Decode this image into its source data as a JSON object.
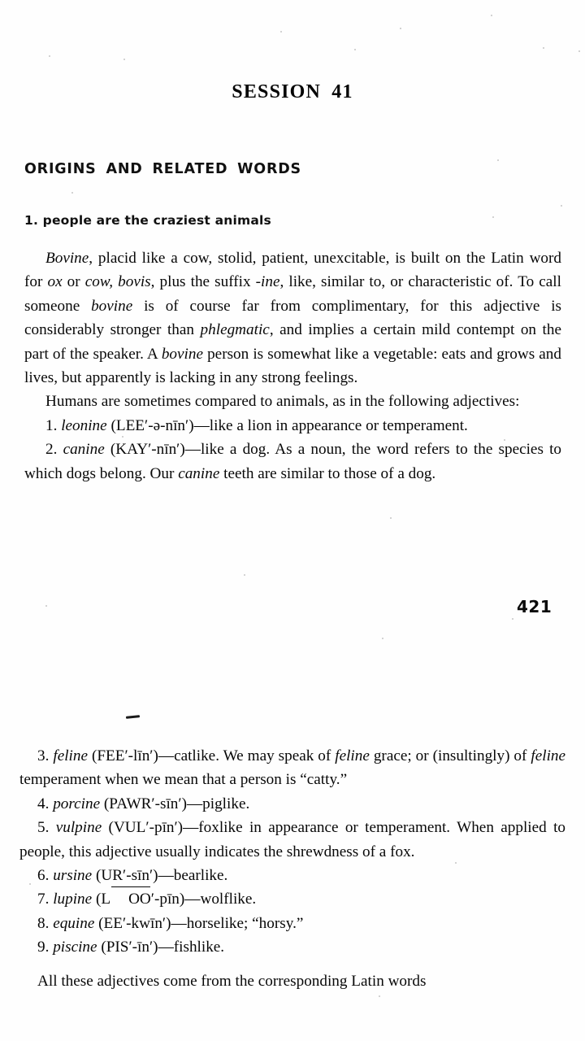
{
  "document": {
    "title": "SESSION 41",
    "page_number": "421",
    "section_heading": "ORIGINS AND RELATED WORDS",
    "subsection_heading": "1. people are the craziest animals"
  },
  "block_one": {
    "paragraph_bovine_lead": "Bovine",
    "paragraph_bovine": ", placid like a cow, stolid, patient, unexcitable, is built on the Latin word for ",
    "word_ox": "ox",
    "paragraph_bovine_2": " or ",
    "word_cow_bovis": "cow, bovis",
    "paragraph_bovine_3": ", plus the suffix ",
    "word_ine": "-ine",
    "paragraph_bovine_4": ", like, similar to, or characteristic of. To call someone ",
    "word_bovine_2": "bovine",
    "paragraph_bovine_5": " is of course far from complimentary, for this adjective is considerably stronger than ",
    "word_phlegmatic": "phlegmatic",
    "paragraph_bovine_6": ", and implies a certain mild contempt on the part of the speaker. A ",
    "word_bovine_3": "bovine",
    "paragraph_bovine_7": " person is somewhat like a vegetable: eats and grows and lives, but apparently is lacking in any strong feelings.",
    "paragraph_humans": "Humans are sometimes compared to animals, as in the following adjectives:",
    "item_1_number": "1. ",
    "item_1_word": "leonine",
    "item_1_rest": " (LEE′-ə-nīn′)—like a lion in appearance or temperament.",
    "item_2_number": "2. ",
    "item_2_word": "canine",
    "item_2_rest_a": " (KAY′-nīn′)—like a dog. As a noun, the word refers to the species to which dogs belong. Our ",
    "item_2_word_b": "canine",
    "item_2_rest_b": " teeth are similar to those of a dog."
  },
  "block_two": {
    "item_3_number": "3. ",
    "item_3_word": "feline",
    "item_3_rest_a": " (FEE′-līn′)—catlike. We may speak of ",
    "item_3_word_b": "feline",
    "item_3_rest_b": " grace; or (insultingly) of ",
    "item_3_word_c": "feline",
    "item_3_rest_c": " temperament when we mean that a person is “catty.”",
    "item_4_number": "4. ",
    "item_4_word": "porcine",
    "item_4_rest": " (PAWR′-sīn′)—piglike.",
    "item_5_number": "5. ",
    "item_5_word": "vulpine",
    "item_5_rest": " (VUL′-pīn′)—foxlike in appearance or temperament. When applied to people, this adjective usually indicates the shrewdness of a fox.",
    "item_6_number": "6. ",
    "item_6_word": "ursine",
    "item_6_rest": " (UR′-sīn′)—bearlike.",
    "item_7_number": "7. ",
    "item_7_word": "lupine",
    "item_7_rest_a": " (L",
    "item_7_oo": "OO",
    "item_7_rest_b": "′-pīn)—wolflike.",
    "item_8_number": "8. ",
    "item_8_word": "equine",
    "item_8_rest": " (EE′-kwīn′)—horselike; “horsy.”",
    "item_9_number": "9. ",
    "item_9_word": "piscine",
    "item_9_rest": " (PIS′-īn′)—fishlike.",
    "closing_paragraph": "All these adjectives come from the corresponding Latin words"
  }
}
